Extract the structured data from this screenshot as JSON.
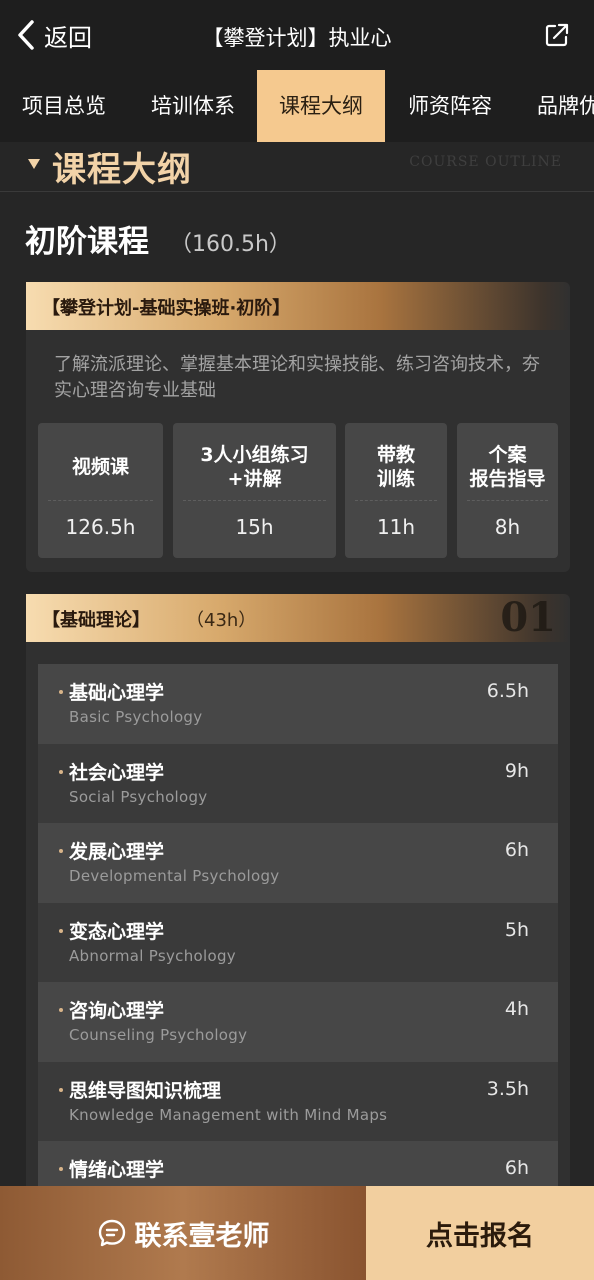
{
  "header": {
    "back_label": "返回",
    "title": "【攀登计划】执业心",
    "share_icon": "share-icon"
  },
  "tabs": [
    {
      "label": "项目总览",
      "active": false
    },
    {
      "label": "培训体系",
      "active": false
    },
    {
      "label": "课程大纲",
      "active": true
    },
    {
      "label": "师资阵容",
      "active": false
    },
    {
      "label": "品牌优",
      "active": false
    }
  ],
  "section": {
    "title": "课程大纲",
    "watermark": "COURSE OUTLINE"
  },
  "level": {
    "title": "初阶课程",
    "hours": "（160.5h）"
  },
  "course_card": {
    "band_title": "【攀登计划-基础实操班·初阶】",
    "description": "了解流派理论、掌握基本理论和实操技能、练习咨询技术，夯实心理咨询专业基础",
    "stats": [
      {
        "label": "视频课",
        "value": "126.5h"
      },
      {
        "label": "3人小组练习\n+讲解",
        "value": "15h"
      },
      {
        "label": "带教\n训练",
        "value": "11h"
      },
      {
        "label": "个案\n报告指导",
        "value": "8h"
      }
    ]
  },
  "module": {
    "title": "【基础理论】",
    "hours": "（43h）",
    "number": "01",
    "items": [
      {
        "title": "基础心理学",
        "subtitle": "Basic Psychology",
        "hours": "6.5h"
      },
      {
        "title": "社会心理学",
        "subtitle": "Social Psychology",
        "hours": "9h"
      },
      {
        "title": "发展心理学",
        "subtitle": "Developmental Psychology",
        "hours": "6h"
      },
      {
        "title": "变态心理学",
        "subtitle": "Abnormal Psychology",
        "hours": "5h"
      },
      {
        "title": "咨询心理学",
        "subtitle": "Counseling Psychology",
        "hours": "4h"
      },
      {
        "title": "思维导图知识梳理",
        "subtitle": "Knowledge Management with Mind Maps",
        "hours": "3.5h"
      },
      {
        "title": "情绪心理学",
        "subtitle": "",
        "hours": "6h"
      }
    ]
  },
  "bottom_bar": {
    "contact_label": "联系壹老师",
    "signup_label": "点击报名"
  },
  "colors": {
    "gold_accent": "#f5c98f",
    "title_gold": "#f2d3a8",
    "background": "#262626",
    "contact_brown": "#9e6a40"
  }
}
